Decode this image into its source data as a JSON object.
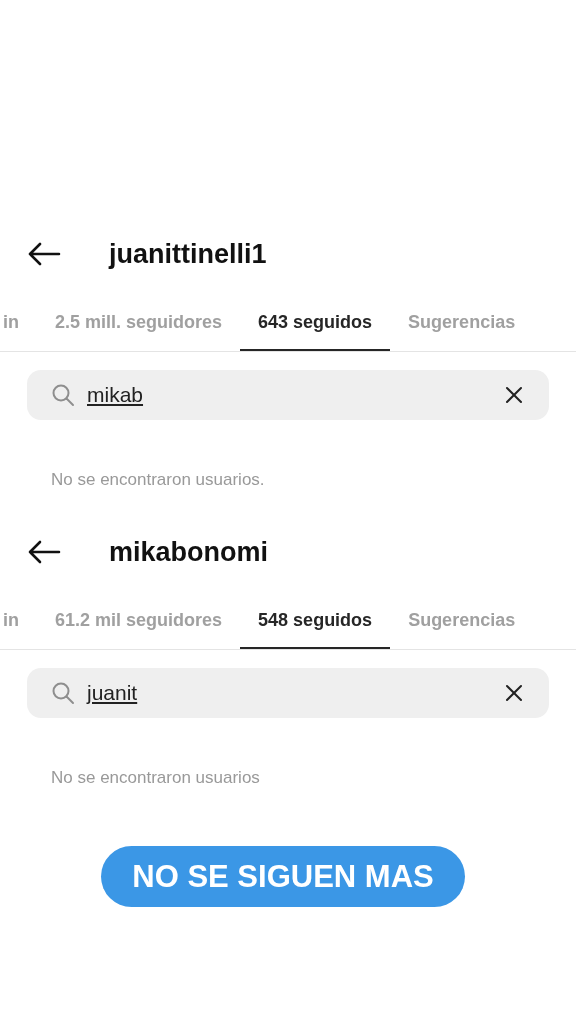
{
  "panels": [
    {
      "username": "juanittinelli1",
      "tabs": [
        {
          "label": "in",
          "selected": false
        },
        {
          "label": "2.5 mill. seguidores",
          "selected": false
        },
        {
          "label": "643 seguidos",
          "selected": true
        },
        {
          "label": "Sugerencias",
          "selected": false
        }
      ],
      "search": {
        "value": "mikab"
      },
      "message": "No se encontraron usuarios."
    },
    {
      "username": "mikabonomi",
      "tabs": [
        {
          "label": "in",
          "selected": false
        },
        {
          "label": "61.2 mil seguidores",
          "selected": false
        },
        {
          "label": "548 seguidos",
          "selected": true
        },
        {
          "label": "Sugerencias",
          "selected": false
        }
      ],
      "search": {
        "value": "juanit"
      },
      "message": "No se encontraron usuarios"
    }
  ],
  "caption": "NO SE SIGUEN MAS"
}
